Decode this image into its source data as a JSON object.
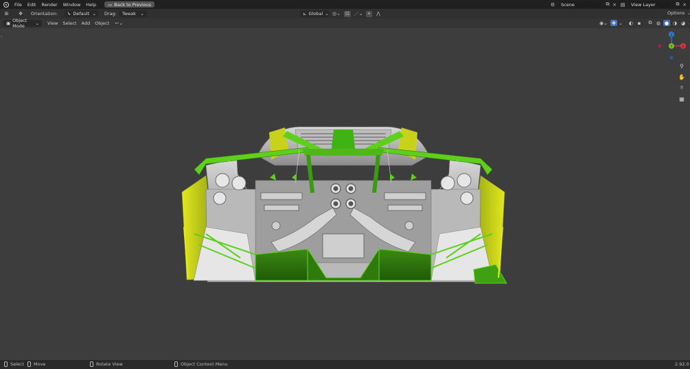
{
  "menu": [
    "File",
    "Edit",
    "Render",
    "Window",
    "Help"
  ],
  "back_button": "Back to Previous",
  "scene": {
    "label": "Scene"
  },
  "view_layer": {
    "label": "View Layer"
  },
  "toolbar": {
    "orientation_label": "Orientation:",
    "orientation_value": "Default",
    "drag_label": "Drag:",
    "drag_value": "Tweak",
    "transform_value": "Global",
    "options_label": "Options"
  },
  "header": {
    "mode": "Object Mode",
    "view": "View",
    "select": "Select",
    "add": "Add",
    "object": "Object"
  },
  "gizmo": {
    "z": "Z",
    "y": "Y",
    "x": "X",
    "colors": {
      "x": "#e0354a",
      "y": "#80c020",
      "z": "#2f7de0"
    }
  },
  "status": {
    "select": "Select",
    "move": "Move",
    "rotate": "Rotate View",
    "context": "Object Context Menu",
    "version": "2.92.0"
  },
  "colors": {
    "selection_green": "#5ed01c",
    "active_yellow": "#c9d21a",
    "body_gray": "#c8c8c8"
  }
}
